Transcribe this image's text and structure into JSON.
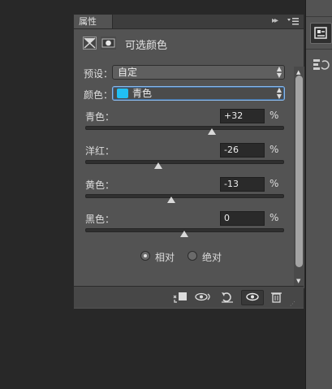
{
  "panel": {
    "tab_label": "属性",
    "collapse_glyph": "▸▸",
    "title": "可选颜色"
  },
  "preset": {
    "label": "预设：",
    "value": "自定"
  },
  "colors": {
    "label": "颜色：",
    "value": "青色",
    "swatch_color": "#21bff3"
  },
  "sliders": [
    {
      "label": "青色：",
      "value": "+32",
      "unit": "%",
      "level": 0.64
    },
    {
      "label": "洋红：",
      "value": "-26",
      "unit": "%",
      "level": 0.37
    },
    {
      "label": "黄色：",
      "value": "-13",
      "unit": "%",
      "level": 0.435
    },
    {
      "label": "黑色：",
      "value": "0",
      "unit": "%",
      "level": 0.5
    }
  ],
  "method": {
    "relative_label": "相对",
    "absolute_label": "绝对",
    "selected": "relative"
  },
  "footer_icons": [
    "clip-to-layer-icon",
    "view-previous-icon",
    "reset-icon",
    "visibility-eye-icon",
    "trash-icon"
  ],
  "dock_icons": [
    "properties-panel-icon",
    "history-panel-icon"
  ]
}
